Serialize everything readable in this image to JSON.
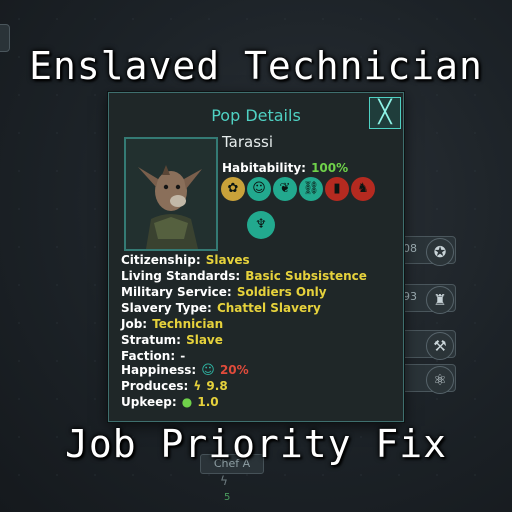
{
  "overlay": {
    "top_title": "Enslaved Technician",
    "bottom_title": "Job Priority Fix"
  },
  "background_ui": {
    "chip_values": [
      "08",
      "93"
    ],
    "bottom_label": "Chef A",
    "bottom_value": "5",
    "side_icons": [
      "rank-icon",
      "spaceship-icon",
      "tools-icon",
      "atom-icon"
    ]
  },
  "panel": {
    "header": "Pop Details",
    "close_symbol": "╳",
    "species": "Tarassi",
    "habitability_label": "Habitability:",
    "habitability_value": "100%",
    "trait_icons": [
      {
        "name": "trait-agrarian-icon",
        "color": "#c9a23a",
        "glyph": "✿"
      },
      {
        "name": "trait-communal-icon",
        "color": "#22a98e",
        "glyph": "☺"
      },
      {
        "name": "trait-rapid-breeders-icon",
        "color": "#22a98e",
        "glyph": "❦"
      },
      {
        "name": "trait-adaptive-icon",
        "color": "#22a98e",
        "glyph": "⛓"
      },
      {
        "name": "trait-decadent-icon",
        "color": "#b52a20",
        "glyph": "▮"
      },
      {
        "name": "trait-strong-icon",
        "color": "#b52a20",
        "glyph": "♞"
      },
      {
        "name": "trait-enslaved-icon",
        "color": "#22a98e",
        "glyph": "♆"
      }
    ],
    "fields": {
      "citizenship_label": "Citizenship:",
      "citizenship_value": "Slaves",
      "living_label": "Living Standards:",
      "living_value": "Basic Subsistence",
      "military_label": "Military Service:",
      "military_value": "Soldiers Only",
      "slavery_label": "Slavery Type:",
      "slavery_value": "Chattel Slavery",
      "job_label": "Job:",
      "job_value": "Technician",
      "stratum_label": "Stratum:",
      "stratum_value": "Slave",
      "faction_label": "Faction:",
      "faction_value": "-",
      "happiness_label": "Happiness:",
      "happiness_value": "20%",
      "produces_label": "Produces:",
      "produces_value": "9.8",
      "upkeep_label": "Upkeep:",
      "upkeep_value": "1.0"
    }
  },
  "colors": {
    "accent": "#4fd1c3",
    "positive": "#6fd24a",
    "value": "#e6d23c",
    "negative": "#e04b3b"
  }
}
